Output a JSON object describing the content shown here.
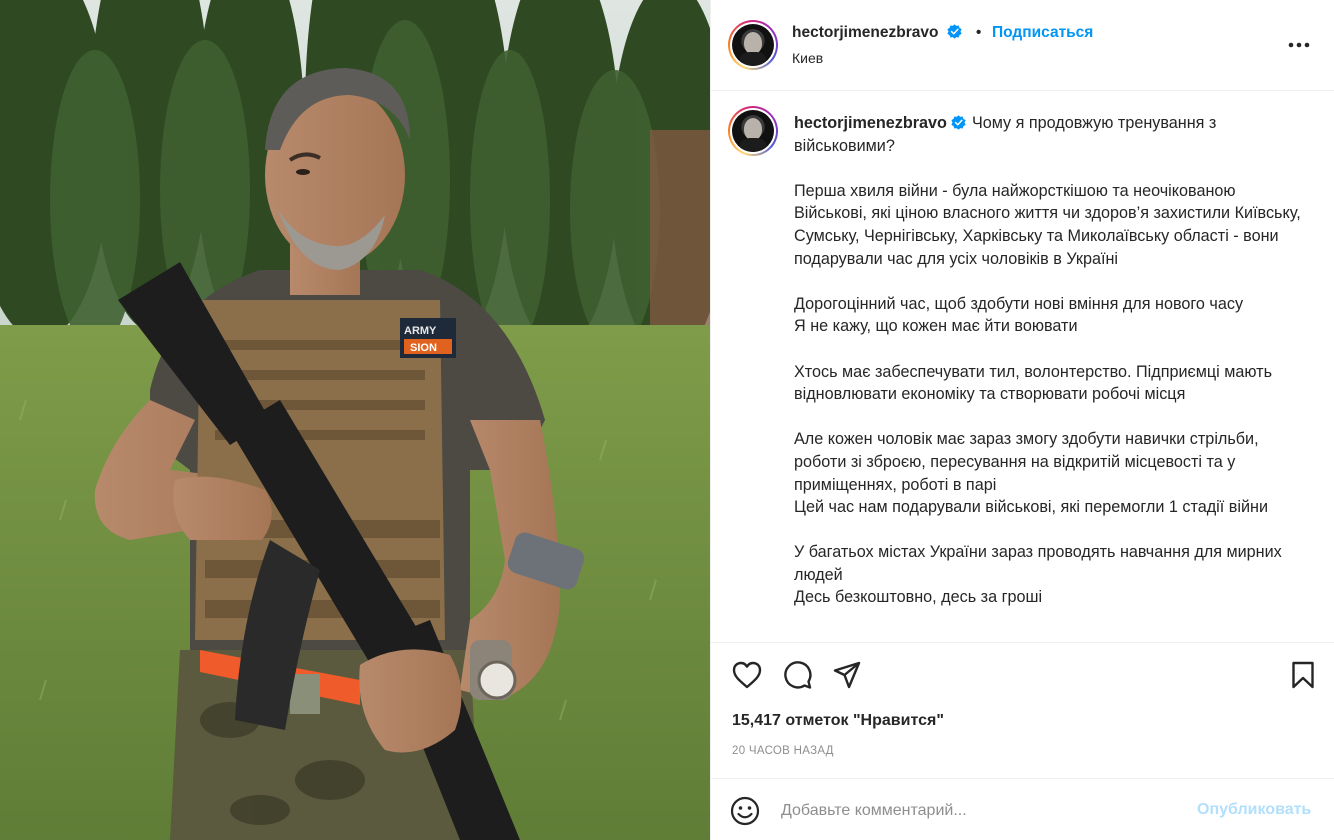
{
  "colors": {
    "accent": "#0095f6",
    "post_disabled": "#b2dffc",
    "text": "#262626",
    "muted": "#8e8e8e"
  },
  "photo": {
    "patch_text_1": "ARMY",
    "patch_text_2": "SION"
  },
  "header": {
    "username": "hectorjimenezbravo",
    "separator": "•",
    "follow_label": "Подписаться",
    "location": "Киев",
    "more_icon": "more-horizontal-icon"
  },
  "caption": {
    "username": "hectorjimenezbravo",
    "text": "Чому я продовжую тренування з військовими?\n\nПерша хвиля війни - була найжорсткішою та неочікованою\nВійськові, які ціною власного життя чи здоров’я захистили Київську, Сумську, Чернігівську, Харківську та Миколаївську області - вони подарували час для усіх чоловіків в Україні\n\nДорогоцінний час, щоб здобути нові вміння для нового часу\nЯ не кажу, що кожен має йти воювати\n\nХтось має забеспечувати тил, волонтерство. Підприємці мають відновлювати економіку та створювати робочі місця\n\nАле кожен чоловік має зараз змогу здобути навички стрільби, роботи зі зброєю, пересування на відкритій місцевості та у приміщеннях, роботі в парі\nЦей час нам подарували військові, які перемогли 1 стадії війни\n\nУ багатьох містах України зараз проводять навчання для мирних людей\nДесь безкоштовно, десь за гроші"
  },
  "actions": {
    "icons": [
      "heart-icon",
      "comment-icon",
      "share-icon",
      "bookmark-icon"
    ],
    "likes": "15,417 отметок \"Нравится\"",
    "time": "20 ЧАСОВ НАЗАД"
  },
  "comment": {
    "placeholder": "Добавьте комментарий...",
    "post_label": "Опубликовать",
    "emoji_icon": "emoji-icon"
  }
}
